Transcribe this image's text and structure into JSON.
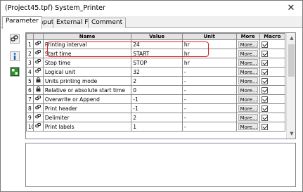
{
  "window": {
    "title": "(Project45.tpf) System_Printer",
    "close_glyph": "✕"
  },
  "tabs": [
    {
      "label": "Parameter",
      "active": true
    },
    {
      "label": "Input",
      "active": false
    },
    {
      "label": "External Files",
      "active": false
    },
    {
      "label": "Comment",
      "active": false
    }
  ],
  "sidebar": {
    "buttons": [
      {
        "icon": "link-icon"
      },
      {
        "icon": "info-icon"
      },
      {
        "icon": "grid-icon"
      }
    ]
  },
  "grid": {
    "headers": [
      "Name",
      "Value",
      "Unit",
      "More",
      "Macro"
    ],
    "more_label": "More...",
    "rows": [
      {
        "num": "1",
        "name": "Printing interval",
        "value": "24",
        "unit": "hr",
        "value_bold": true,
        "icon": "link-icon"
      },
      {
        "num": "2",
        "name": "Start time",
        "value": "START",
        "unit": "hr",
        "value_bold": false,
        "icon": "link-icon"
      },
      {
        "num": "3",
        "name": "Stop time",
        "value": "STOP",
        "unit": "hr",
        "value_bold": false,
        "icon": "link-icon"
      },
      {
        "num": "4",
        "name": "Logical unit",
        "value": "32",
        "unit": "-",
        "value_bold": true,
        "icon": "link-icon"
      },
      {
        "num": "5",
        "name": "Units printing mode",
        "value": "2",
        "unit": "-",
        "value_bold": false,
        "icon": "lock-icon"
      },
      {
        "num": "6",
        "name": "Relative or absolute start time",
        "value": "0",
        "unit": "-",
        "value_bold": false,
        "icon": "lock-icon"
      },
      {
        "num": "7",
        "name": "Overwrite or Append",
        "value": "-1",
        "unit": "-",
        "value_bold": false,
        "icon": "link-icon"
      },
      {
        "num": "8",
        "name": "Print header",
        "value": "-1",
        "unit": "-",
        "value_bold": false,
        "icon": "link-icon"
      },
      {
        "num": "9",
        "name": "Delimiter",
        "value": "2",
        "unit": "-",
        "value_bold": true,
        "icon": "link-icon"
      },
      {
        "num": "10",
        "name": "Print labels",
        "value": "1",
        "unit": "-",
        "value_bold": false,
        "icon": "link-icon"
      }
    ]
  },
  "colors": {
    "highlight": "#e02020",
    "macro_green": "#2f8f2f",
    "info_blue": "#1a5fb4"
  }
}
